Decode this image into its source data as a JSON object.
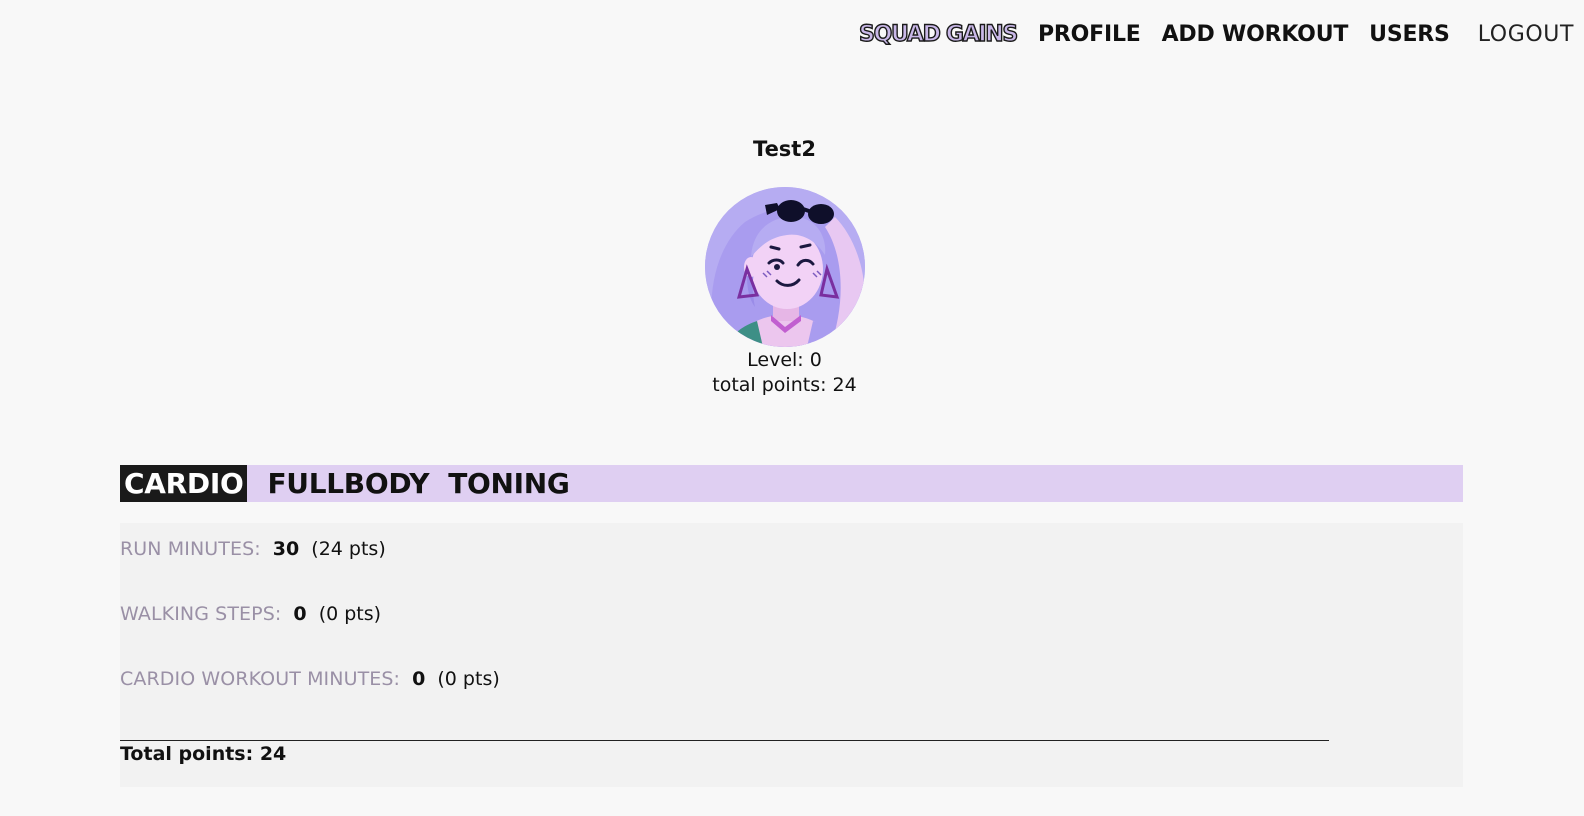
{
  "nav": {
    "brand": "SQUAD GAINS",
    "profile": "PROFILE",
    "add_workout": "ADD WORKOUT",
    "users": "USERS",
    "logout": "LOGOUT"
  },
  "profile": {
    "username": "Test2",
    "level": "Level: 0",
    "total_points": "total points: 24"
  },
  "tabs": [
    {
      "label": "CARDIO",
      "active": true
    },
    {
      "label": "FULLBODY",
      "active": false
    },
    {
      "label": "TONING",
      "active": false
    }
  ],
  "cardio": {
    "rows": [
      {
        "label": "RUN MINUTES:",
        "value": "30",
        "points": "(24 pts)"
      },
      {
        "label": "WALKING STEPS:",
        "value": "0",
        "points": "(0 pts)"
      },
      {
        "label": "CARDIO WORKOUT MINUTES:",
        "value": "0",
        "points": "(0 pts)"
      }
    ],
    "total": "Total points: 24"
  },
  "colors": {
    "background": "#f8f8f8",
    "brand_fill": "#c9b8e8",
    "tab_bar": "#dfcff2",
    "active_tab": "#1a1a1a",
    "panel": "#f2f2f2",
    "label_muted": "#9a90a6"
  }
}
